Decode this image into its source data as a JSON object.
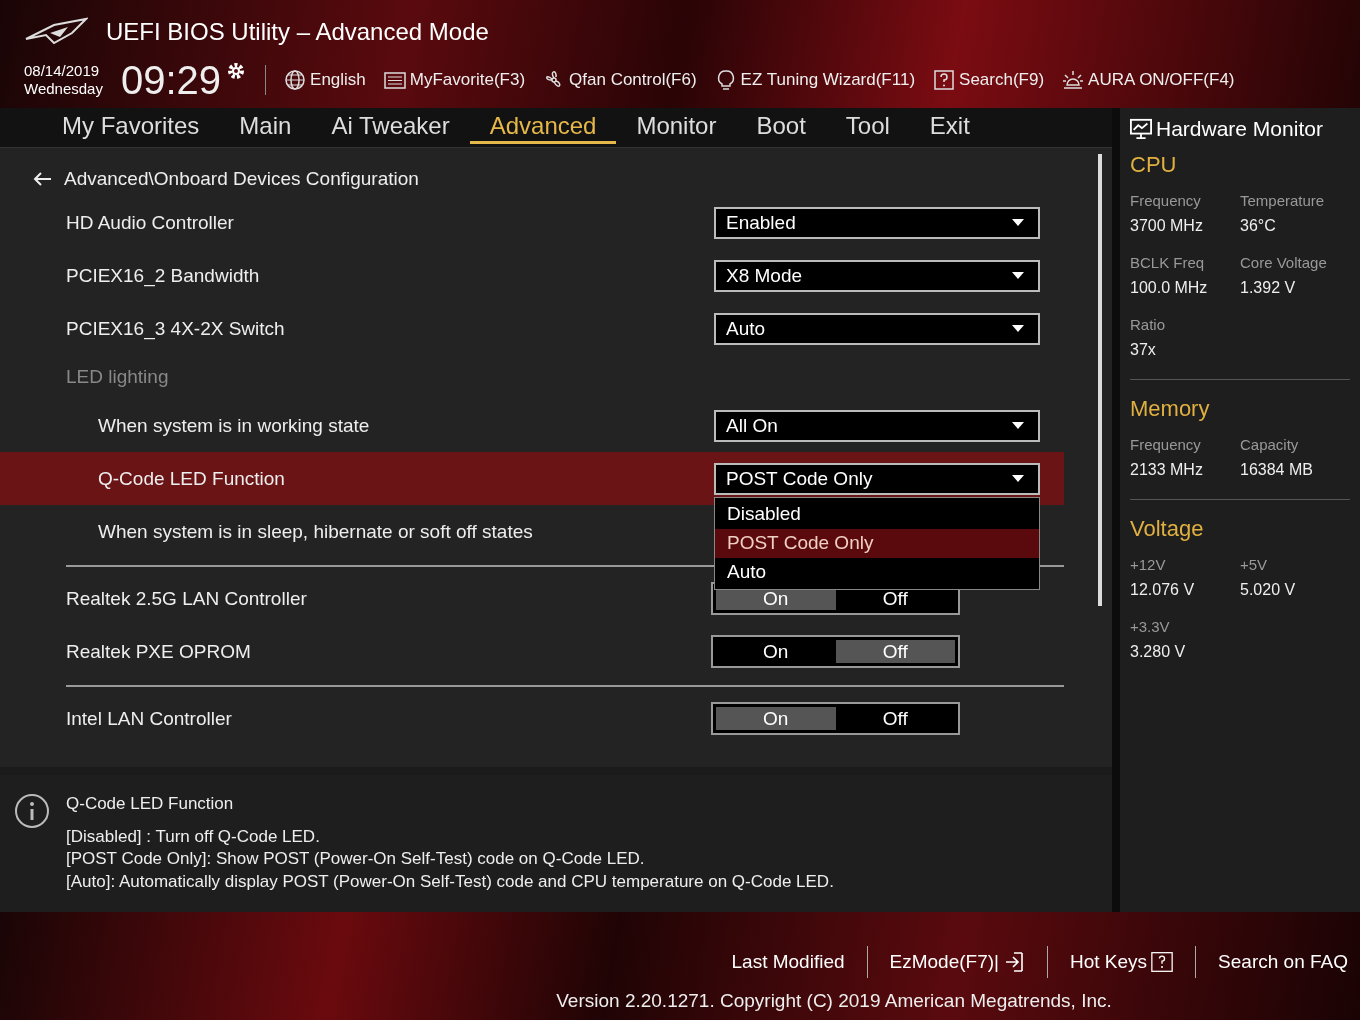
{
  "window": {
    "title": "UEFI BIOS Utility – Advanced Mode"
  },
  "clock": {
    "date": "08/14/2019",
    "weekday": "Wednesday",
    "time": "09:29"
  },
  "toolbar": [
    {
      "kind": "globe",
      "label": "English"
    },
    {
      "kind": "list",
      "label": "MyFavorite(F3)"
    },
    {
      "kind": "fan",
      "label": "Qfan Control(F6)"
    },
    {
      "kind": "bulb",
      "label": "EZ Tuning Wizard(F11)"
    },
    {
      "kind": "question",
      "label": "Search(F9)"
    },
    {
      "kind": "aura",
      "label": "AURA ON/OFF(F4)"
    }
  ],
  "tabs": [
    {
      "label": "My Favorites",
      "selected": false
    },
    {
      "label": "Main",
      "selected": false
    },
    {
      "label": "Ai Tweaker",
      "selected": false
    },
    {
      "label": "Advanced",
      "selected": true
    },
    {
      "label": "Monitor",
      "selected": false
    },
    {
      "label": "Boot",
      "selected": false
    },
    {
      "label": "Tool",
      "selected": false
    },
    {
      "label": "Exit",
      "selected": false
    }
  ],
  "breadcrumb": "Advanced\\Onboard Devices Configuration",
  "rows": [
    {
      "kind": "dropdown",
      "label": "HD Audio Controller",
      "value": "Enabled",
      "selected": false
    },
    {
      "kind": "dropdown",
      "label": "PCIEX16_2 Bandwidth",
      "value": "X8 Mode",
      "selected": false
    },
    {
      "kind": "dropdown",
      "label": "PCIEX16_3 4X-2X Switch",
      "value": "Auto",
      "selected": false
    },
    {
      "kind": "heading",
      "label": "LED lighting",
      "children": [
        {
          "kind": "dropdown",
          "label": "When system is in working state",
          "value": "All On",
          "selected": false
        },
        {
          "kind": "dropdown",
          "label": "Q-Code LED Function",
          "value": "POST Code Only",
          "selected": true,
          "open": true,
          "options": [
            {
              "label": "Disabled",
              "selected": false
            },
            {
              "label": "POST Code Only",
              "selected": true
            },
            {
              "label": "Auto",
              "selected": false
            }
          ]
        },
        {
          "kind": "text",
          "label": "When system is in sleep, hibernate or soft off states",
          "selected": false
        }
      ]
    },
    {
      "kind": "divider"
    },
    {
      "kind": "toggle",
      "label": "Realtek 2.5G LAN Controller",
      "on_label": "On",
      "off_label": "Off",
      "on": true,
      "selected": false
    },
    {
      "kind": "toggle",
      "label": "Realtek PXE OPROM",
      "on_label": "On",
      "off_label": "Off",
      "on": false,
      "selected": false
    },
    {
      "kind": "divider"
    },
    {
      "kind": "toggle",
      "label": "Intel LAN Controller",
      "on_label": "On",
      "off_label": "Off",
      "on": true,
      "selected": false
    }
  ],
  "help": {
    "title": "Q-Code LED Function",
    "lines": [
      "[Disabled] : Turn off Q-Code LED.",
      "[POST Code Only]: Show POST (Power-On Self-Test) code on Q-Code LED.",
      "[Auto]: Automatically display POST (Power-On Self-Test) code and CPU temperature on Q-Code LED."
    ]
  },
  "hardware_monitor": {
    "title": "Hardware Monitor",
    "sections": [
      {
        "title": "CPU",
        "items": [
          {
            "label": "Frequency",
            "value": "3700 MHz"
          },
          {
            "label": "Temperature",
            "value": "36°C"
          },
          {
            "label": "BCLK Freq",
            "value": "100.0 MHz"
          },
          {
            "label": "Core Voltage",
            "value": "1.392 V"
          },
          {
            "label": "Ratio",
            "value": "37x"
          }
        ]
      },
      {
        "title": "Memory",
        "items": [
          {
            "label": "Frequency",
            "value": "2133 MHz"
          },
          {
            "label": "Capacity",
            "value": "16384 MB"
          }
        ]
      },
      {
        "title": "Voltage",
        "items": [
          {
            "label": "+12V",
            "value": "12.076 V"
          },
          {
            "label": "+5V",
            "value": "5.020 V"
          },
          {
            "label": "+3.3V",
            "value": "3.280 V"
          }
        ]
      }
    ]
  },
  "footer": {
    "buttons": [
      {
        "kind": "plain",
        "label": "Last Modified"
      },
      {
        "kind": "exit",
        "label": "EzMode(F7)|"
      },
      {
        "kind": "help",
        "label": "Hot Keys"
      },
      {
        "kind": "plain",
        "label": "Search on FAQ"
      }
    ],
    "version": "Version 2.20.1271. Copyright (C) 2019 American Megatrends, Inc."
  }
}
